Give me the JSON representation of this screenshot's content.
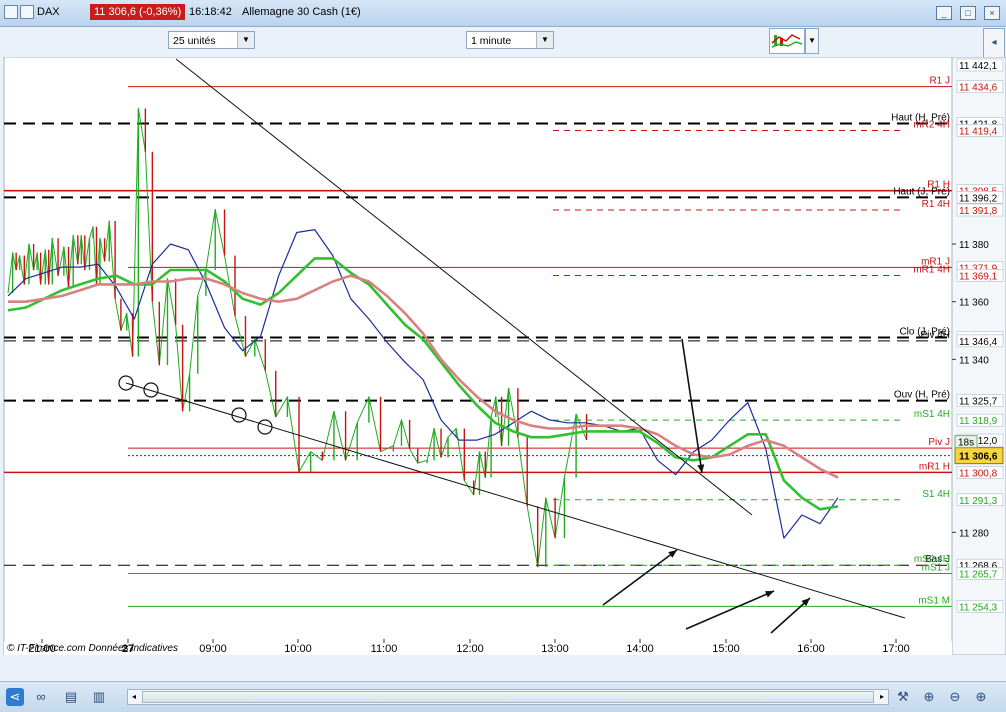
{
  "window": {
    "symbol": "DAX",
    "price_badge": "11 306,6 (-0,36%)",
    "time": "16:18:42",
    "instrument": "Allemagne 30 Cash (1€)"
  },
  "toolbar": {
    "units_select": "25 unités",
    "interval_select": "1 minute"
  },
  "chart_data": {
    "type": "line",
    "title": "",
    "xlabel": "",
    "ylabel": "",
    "ylim": [
      11249,
      11446
    ],
    "x_ticks": [
      "21:00",
      "27",
      "09:00",
      "10:00",
      "11:00",
      "12:00",
      "13:00",
      "14:00",
      "15:00",
      "16:00",
      "17:00"
    ],
    "y_ticks": [
      "11 380",
      "11 360",
      "11 340",
      "11 280"
    ],
    "series": [
      {
        "color": "#22aa22",
        "t": [
          0,
          4,
          7,
          10,
          14,
          18,
          22,
          25,
          28,
          32,
          35,
          38,
          43,
          48,
          52,
          56,
          60,
          63,
          66,
          70,
          73,
          76,
          79,
          83,
          87,
          92,
          97,
          102,
          107,
          112,
          118,
          124,
          130,
          137,
          144,
          150,
          156,
          163,
          170,
          178,
          186,
          195,
          204,
          212,
          221,
          230,
          240,
          250,
          260,
          270,
          280,
          290,
          300,
          310,
          320,
          331,
          338,
          345,
          352,
          360,
          366,
          372,
          378,
          385,
          392,
          400,
          405,
          410,
          415,
          419,
          424,
          430,
          438,
          446,
          455,
          462,
          470,
          478,
          488,
          497,
          507,
          517,
          528,
          539,
          550,
          561,
          572,
          583,
          594,
          605,
          616,
          628,
          640,
          652,
          664,
          676,
          685,
          695,
          704,
          713
        ],
        "values": [
          11363,
          11377,
          11371,
          11376,
          11366,
          11380,
          11371,
          11377,
          11366,
          11378,
          11366,
          11382,
          11369,
          11379,
          11365,
          11383,
          11373,
          11383,
          11371,
          11382,
          11386,
          11366,
          11382,
          11374,
          11388,
          11361,
          11350,
          11356,
          11341,
          11427,
          11412,
          11360,
          11338,
          11368,
          11352,
          11322,
          11335,
          11362,
          11371,
          11392,
          11376,
          11355,
          11341,
          11347,
          11336,
          11320,
          11327,
          11301,
          11308,
          11305,
          11322,
          11305,
          11318,
          11327,
          11308,
          11310,
          11319,
          11309,
          11304,
          11305,
          11316,
          11306,
          11313,
          11316,
          11298,
          11293,
          11308,
          11299,
          11320,
          11327,
          11310,
          11330,
          11313,
          11289,
          11268,
          11292,
          11278,
          11299,
          11321,
          11312
        ]
      },
      {
        "color": "#1c2c9c",
        "values": [
          11362,
          11368,
          11370,
          11372,
          11372,
          11373,
          11365,
          11354,
          11373,
          11380,
          11378,
          11366,
          11351,
          11343,
          11348,
          11369,
          11384,
          11385,
          11376,
          11361,
          11354,
          11346,
          11339,
          11333,
          11319,
          11312,
          11312,
          11314,
          11318,
          11322,
          11319,
          11318,
          11318,
          11317,
          11315,
          11316,
          11305,
          11300,
          11308,
          11312,
          11319,
          11325,
          11309,
          11278,
          11286,
          11283,
          11292
        ]
      },
      {
        "color": "#30c030",
        "values": [
          11357,
          11358,
          11361,
          11364,
          11366,
          11368,
          11369,
          11366,
          11366,
          11371,
          11371,
          11371,
          11367,
          11361,
          11359,
          11363,
          11369,
          11375,
          11375,
          11370,
          11366,
          11359,
          11352,
          11347,
          11339,
          11331,
          11324,
          11318,
          11315,
          11313,
          11313,
          11314,
          11315,
          11315,
          11315,
          11315,
          11311,
          11306,
          11305,
          11306,
          11310,
          11314,
          11314,
          11298,
          11292,
          11288,
          11289
        ]
      },
      {
        "color": "#d98080",
        "values": [
          11360,
          11360,
          11361,
          11362,
          11364,
          11366,
          11366,
          11366,
          11367,
          11367,
          11368,
          11368,
          11366,
          11363,
          11361,
          11360,
          11361,
          11364,
          11367,
          11369,
          11367,
          11362,
          11356,
          11349,
          11340,
          11333,
          11327,
          11322,
          11319,
          11317,
          11316,
          11316,
          11317,
          11317,
          11317,
          11316,
          11314,
          11310,
          11307,
          11306,
          11307,
          11310,
          11312,
          11310,
          11306,
          11302,
          11299
        ]
      }
    ],
    "horizontal_levels": [
      {
        "name": "R1 J",
        "value": 11434.6,
        "style": "solid",
        "color": "#cc1111"
      },
      {
        "name": "Haut (H, Pré)",
        "value": 11421.8,
        "style": "dashed",
        "color": "#000000"
      },
      {
        "name": "mR2 4H",
        "value": 11419.4,
        "style": "dashed",
        "color": "#cc1111"
      },
      {
        "name": "R1 H",
        "value": 11398.5,
        "style": "solid",
        "color": "#cc1111"
      },
      {
        "name": "Haut (J, Pré)",
        "value": 11396.2,
        "style": "dashed",
        "color": "#000000"
      },
      {
        "name": "R1 4H",
        "value": 11391.8,
        "style": "dashed",
        "color": "#cc1111"
      },
      {
        "name": "mR1 J",
        "value": 11371.9,
        "style": "solid",
        "color": "#cc1111"
      },
      {
        "name": "mR1 4H",
        "value": 11369.1,
        "style": "dashed",
        "color": "#cc1111"
      },
      {
        "name": "Clo (J, Pré)",
        "value": 11347.6,
        "style": "dashed",
        "color": "#000000"
      },
      {
        "name": "Piv 4H",
        "value": 11346.4,
        "style": "dashed",
        "color": "#000000"
      },
      {
        "name": "Ouv (H, Pré)",
        "value": 11325.7,
        "style": "dashed",
        "color": "#000000"
      },
      {
        "name": "mS1 4H",
        "value": 11318.9,
        "style": "dashed",
        "color": "#22aa22"
      },
      {
        "name": "Piv J",
        "value": 11309.2,
        "style": "solid",
        "color": "#cc1111"
      },
      {
        "name": "mR1 H",
        "value": 11300.8,
        "style": "solid",
        "color": "#cc1111"
      },
      {
        "name": "S1 4H",
        "value": 11291.3,
        "style": "dashed",
        "color": "#22aa22"
      },
      {
        "name": "Bas J",
        "value": 11268.6,
        "style": "dashed",
        "color": "#000000"
      },
      {
        "name": "mS2 4H",
        "value": 11268.6,
        "style": "dashed",
        "color": "#22aa22"
      },
      {
        "name": "mS1 J",
        "value": 11265.7,
        "style": "solid",
        "color": "#22aa22"
      },
      {
        "name": "mS1 M",
        "value": 11254.3,
        "style": "solid",
        "color": "#22aa22"
      }
    ],
    "price_labels": [
      {
        "text": "11 442,1",
        "value": 11442.1,
        "bg": "#ffffff",
        "fg": "#000000"
      },
      {
        "text": "11 434,6",
        "value": 11434.6,
        "bg": "#ffffff",
        "fg": "#cc1111"
      },
      {
        "text": "11 421,8",
        "value": 11421.8,
        "bg": "#ffffff",
        "fg": "#000000"
      },
      {
        "text": "11 419,4",
        "value": 11419.4,
        "bg": "#ffffff",
        "fg": "#cc1111"
      },
      {
        "text": "11 398,5",
        "value": 11398.5,
        "bg": "#ffffff",
        "fg": "#cc1111"
      },
      {
        "text": "11 396,2",
        "value": 11396.2,
        "bg": "#ffffff",
        "fg": "#000000"
      },
      {
        "text": "11 391,8",
        "value": 11391.8,
        "bg": "#ffffff",
        "fg": "#cc1111"
      },
      {
        "text": "11 371,9",
        "value": 11371.9,
        "bg": "#ffffff",
        "fg": "#cc1111"
      },
      {
        "text": "11 369,1",
        "value": 11369.1,
        "bg": "#ffffff",
        "fg": "#cc1111"
      },
      {
        "text": "11 347,6",
        "value": 11347.6,
        "bg": "#ffffff",
        "fg": "#000000"
      },
      {
        "text": "11 346,4",
        "value": 11346.4,
        "bg": "#ffffff",
        "fg": "#000000"
      },
      {
        "text": "11 325,7",
        "value": 11325.7,
        "bg": "#ffffff",
        "fg": "#000000"
      },
      {
        "text": "11 318,9",
        "value": 11318.9,
        "bg": "#ffffff",
        "fg": "#22aa22"
      },
      {
        "text": "11 312,0",
        "value": 11312.0,
        "bg": "#ffffff",
        "fg": "#000000"
      },
      {
        "text": "11 300,8",
        "value": 11300.8,
        "bg": "#ffffff",
        "fg": "#cc1111"
      },
      {
        "text": "11 291,3",
        "value": 11291.3,
        "bg": "#ffffff",
        "fg": "#22aa22"
      },
      {
        "text": "11 268,6",
        "value": 11268.6,
        "bg": "#ffffff",
        "fg": "#000000"
      },
      {
        "text": "11 265,7",
        "value": 11265.7,
        "bg": "#ffffff",
        "fg": "#22aa22"
      },
      {
        "text": "11 254,3",
        "value": 11254.3,
        "bg": "#ffffff",
        "fg": "#22aa22"
      }
    ],
    "current": {
      "countdown": "18s",
      "price": "11 306,6",
      "value": 11306.6
    }
  },
  "watermark": "© IT-Finance.com  Données indicatives",
  "colors": {
    "bull": "#22aa22",
    "bear": "#cc1111",
    "ma_fast": "#1c2c9c",
    "ma_mid": "#30c030",
    "ma_slow": "#d98080"
  }
}
